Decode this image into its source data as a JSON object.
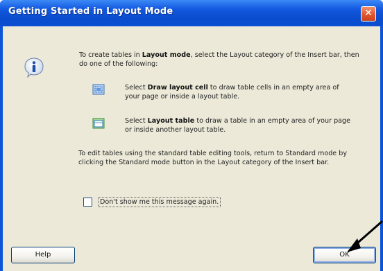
{
  "window": {
    "title": "Getting Started in Layout Mode",
    "close_symbol": "✕"
  },
  "body": {
    "intro": {
      "before": "To create tables in ",
      "bold": "Layout mode",
      "after": ", select the Layout category of the Insert bar, then do one of the following:"
    },
    "options": [
      {
        "icon": "draw-layout-cell-icon",
        "before": "Select ",
        "bold": "Draw layout cell",
        "after": " to draw table cells in an empty area of your page or inside a layout table."
      },
      {
        "icon": "layout-table-icon",
        "before": "Select ",
        "bold": "Layout table",
        "after": " to draw a table in an empty area of your page or inside another layout table."
      }
    ],
    "standard_note": "To edit tables using the standard table editing tools, return to Standard mode by clicking the Standard mode button in the Layout category of the Insert bar."
  },
  "checkbox": {
    "label": "Don't show me this message again.",
    "checked": false
  },
  "buttons": {
    "help": "Help",
    "ok": "OK"
  },
  "colors": {
    "titlebar": "#0a4ccc",
    "client": "#ece9d8",
    "close_button": "#e0532b"
  }
}
